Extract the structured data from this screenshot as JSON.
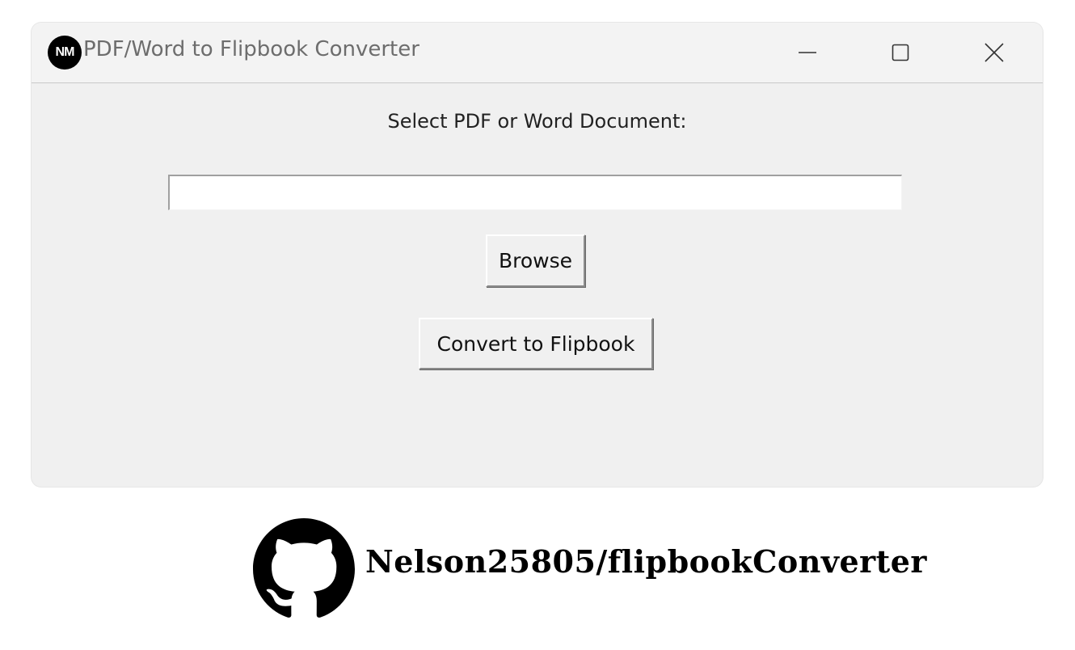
{
  "window": {
    "app_icon_text": "NM",
    "title": "PDF/Word to Flipbook Converter",
    "controls": {
      "minimize_icon": "minimize-icon",
      "maximize_icon": "maximize-icon",
      "close_icon": "close-icon"
    }
  },
  "form": {
    "prompt_label": "Select PDF or Word Document:",
    "file_path_value": "",
    "browse_label": "Browse",
    "convert_label": "Convert to Flipbook"
  },
  "footer": {
    "github_icon": "github-icon",
    "repo_text": "Nelson25805/flipbookConverter"
  },
  "colors": {
    "window_bg": "#f0f0f0",
    "titlebar_text": "#6d6d6d",
    "page_bg": "#ffffff"
  }
}
